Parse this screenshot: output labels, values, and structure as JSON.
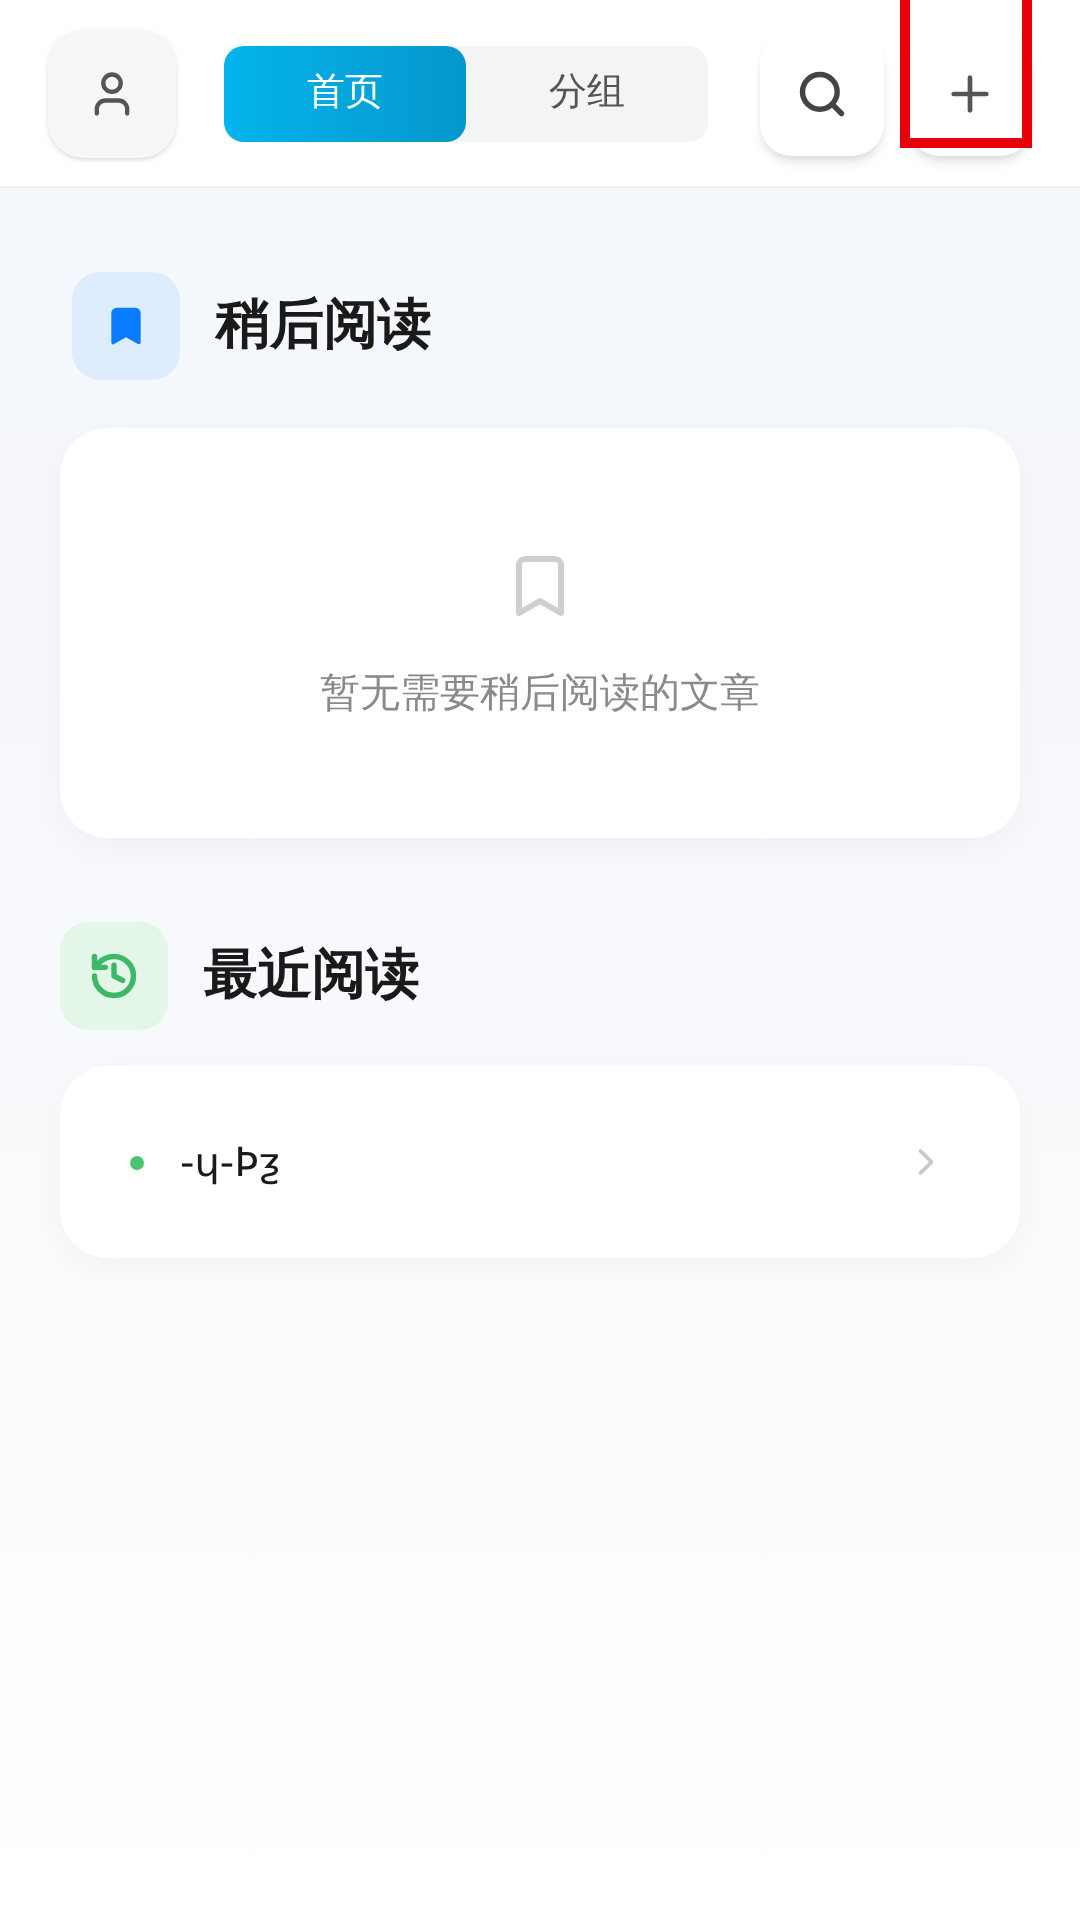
{
  "header": {
    "tabs": [
      {
        "label": "首页",
        "selected": true
      },
      {
        "label": "分组",
        "selected": false
      }
    ],
    "add_button": {
      "highlighted": true
    }
  },
  "read_later": {
    "title": "稍后阅读",
    "empty_text": "暂无需要稍后阅读的文章"
  },
  "recent": {
    "title": "最近阅读",
    "items": [
      {
        "title": "-ɥ-Þƺ",
        "color": "#4cc46e"
      }
    ]
  }
}
